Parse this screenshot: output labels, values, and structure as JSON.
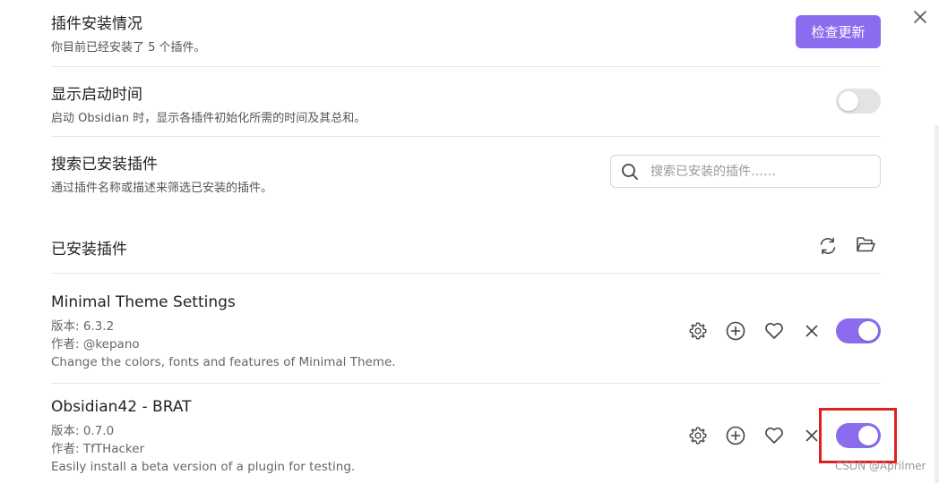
{
  "header": {
    "title": "插件安装情况",
    "subtitle": "你目前已经安装了 5 个插件。",
    "check_update_label": "检查更新"
  },
  "settings": {
    "startup_time": {
      "title": "显示启动时间",
      "desc": "启动 Obsidian 时，显示各插件初始化所需的时间及其总和。",
      "enabled": false
    },
    "search": {
      "title": "搜索已安装插件",
      "desc": "通过插件名称或描述来筛选已安装的插件。",
      "placeholder": "搜索已安装的插件……"
    }
  },
  "installed": {
    "heading": "已安装插件",
    "plugins": [
      {
        "name": "Minimal Theme Settings",
        "version": "版本: 6.3.2",
        "author": "作者: @kepano",
        "description": "Change the colors, fonts and features of Minimal Theme.",
        "enabled": true
      },
      {
        "name": "Obsidian42 - BRAT",
        "version": "版本: 0.7.0",
        "author": "作者: TfTHacker",
        "description": "Easily install a beta version of a plugin for testing.",
        "enabled": true
      }
    ]
  },
  "watermark": "CSDN @Aprilmer",
  "colors": {
    "accent": "#8b6cef",
    "highlight": "#e02020"
  },
  "icons": [
    "close-icon",
    "search-icon",
    "reload-icon",
    "folder-open-icon",
    "gear-icon",
    "plus-circle-icon",
    "heart-icon",
    "x-icon"
  ]
}
